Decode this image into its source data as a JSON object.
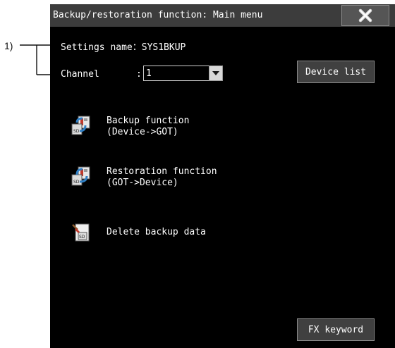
{
  "callout": {
    "label": "1)"
  },
  "window": {
    "title": "Backup/restoration function: Main menu"
  },
  "settings": {
    "name_text": "Settings name：SYS1BKUP"
  },
  "channel": {
    "label": "Channel",
    "colon": ":",
    "value": "1"
  },
  "buttons": {
    "device_list": "Device list",
    "fx_keyword": "FX keyword"
  },
  "menu": {
    "backup": {
      "line1": "Backup function",
      "line2": "(Device->GOT)",
      "icon": "backup-icon"
    },
    "restore": {
      "line1": "Restoration function",
      "line2": "(GOT->Device)",
      "icon": "restore-icon"
    },
    "delete": {
      "line1": "Delete backup data",
      "icon": "delete-data-icon"
    }
  },
  "icons": {
    "close": "close-icon",
    "dropdown": "chevron-down-icon"
  },
  "colors": {
    "screen_bg": "#000000",
    "titlebar_bg": "#3c3c3c",
    "button_bg": "#404040",
    "accent_red": "#c0392b",
    "accent_blue": "#2f7fc4"
  }
}
